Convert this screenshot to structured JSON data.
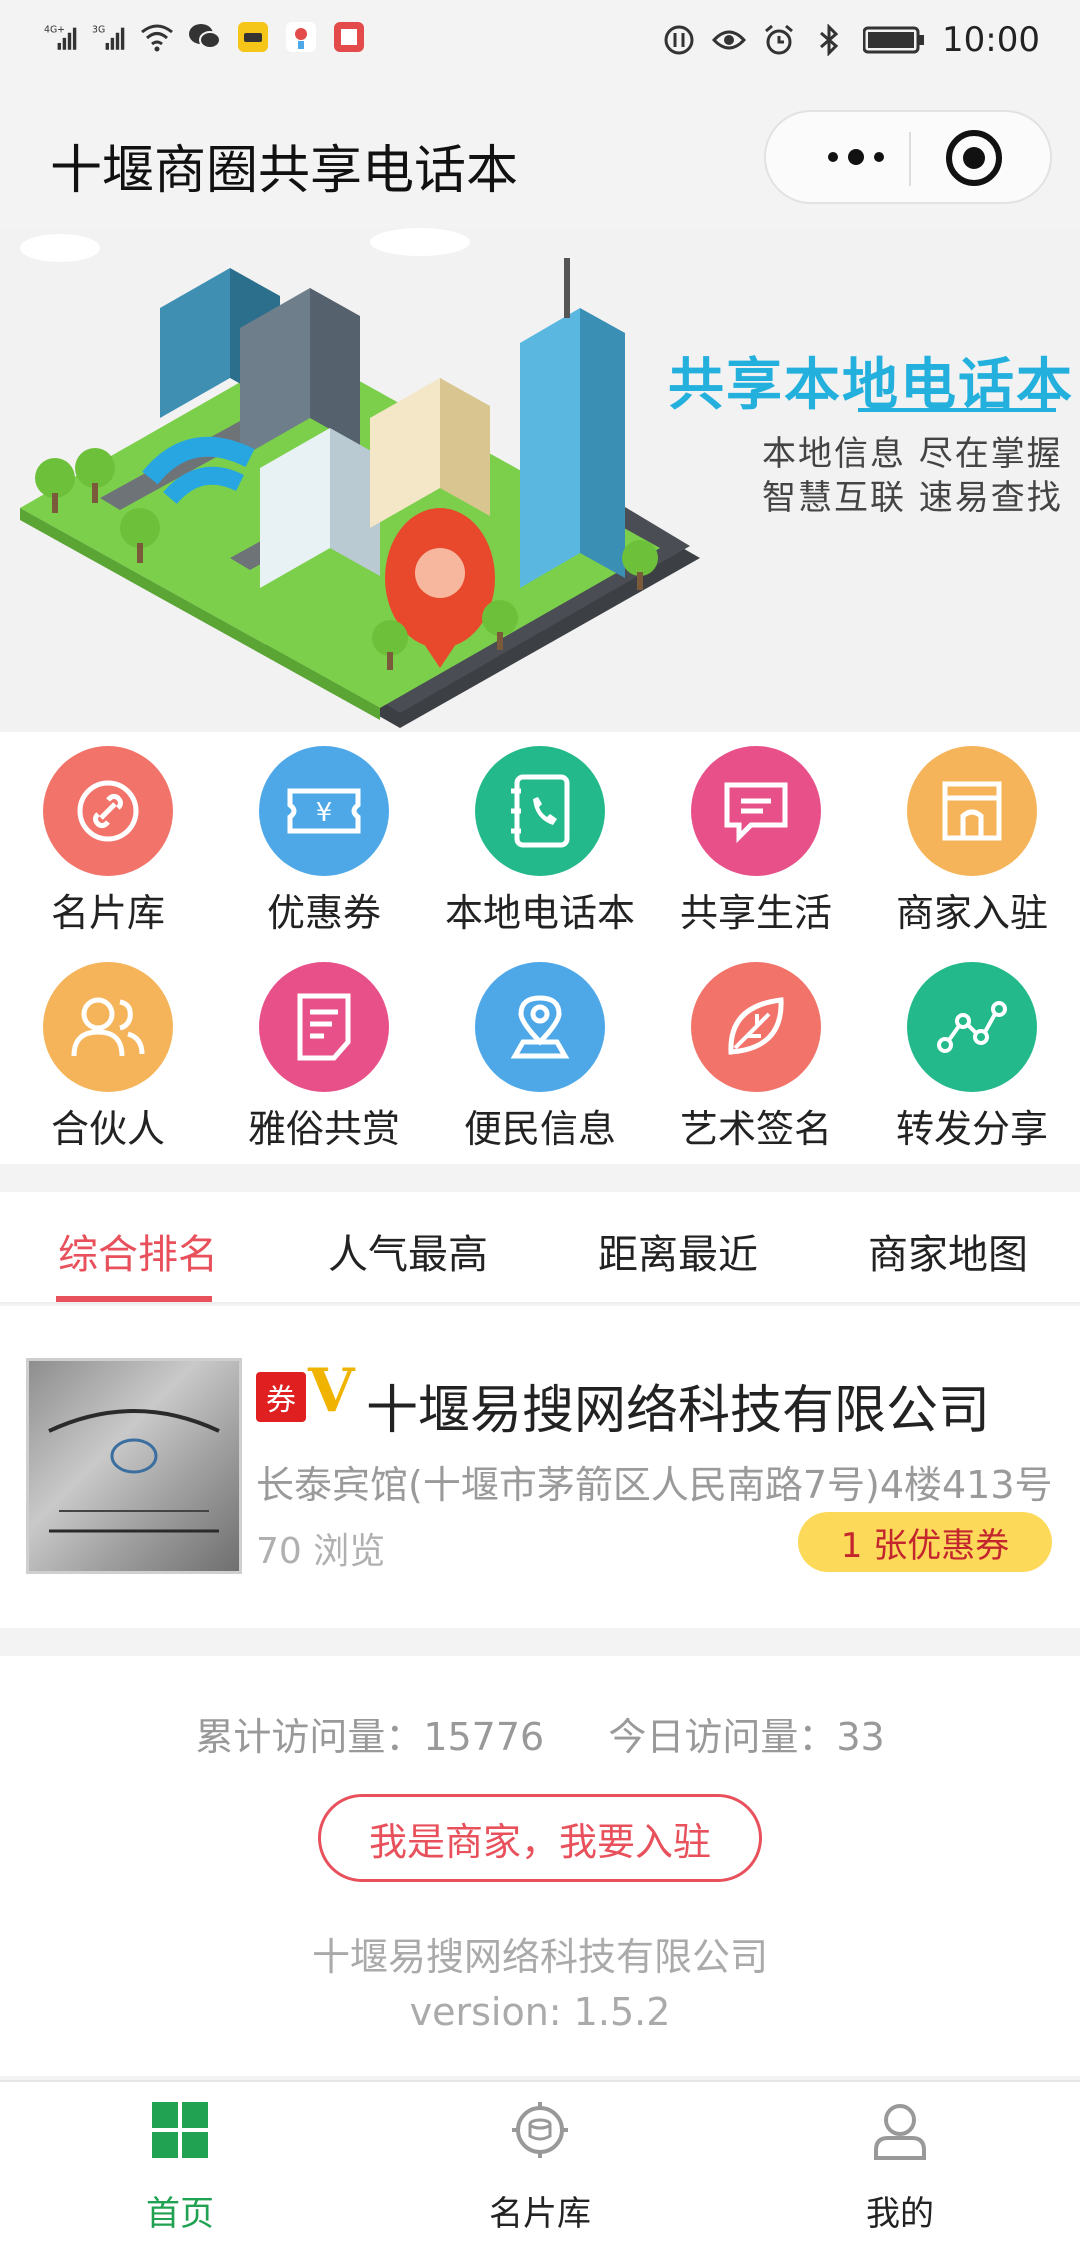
{
  "status_bar": {
    "network_1": "4G+",
    "network_2": "3G",
    "time": "10:00",
    "icons_left": [
      "signal-icon",
      "signal-icon",
      "wifi-icon",
      "wechat-icon",
      "car-icon",
      "map-pin-icon",
      "book-icon"
    ],
    "icons_right": [
      "data-icon",
      "eye-icon",
      "alarm-icon",
      "bluetooth-icon",
      "battery-icon"
    ]
  },
  "nav": {
    "title": "十堰商圈共享电话本"
  },
  "banner": {
    "headline": "共享本地电话本",
    "sub1": "本地信息 尽在掌握",
    "sub2": "智慧互联 速易查找",
    "accent": "#23b0dd"
  },
  "grid": {
    "items": [
      {
        "label": "名片库",
        "icon": "link-icon",
        "color": "#f2736a"
      },
      {
        "label": "优惠券",
        "icon": "ticket-icon",
        "color": "#4ea8e8"
      },
      {
        "label": "本地电话本",
        "icon": "phonebook-icon",
        "color": "#23b98b"
      },
      {
        "label": "共享生活",
        "icon": "chat-icon",
        "color": "#e8508a"
      },
      {
        "label": "商家入驻",
        "icon": "store-icon",
        "color": "#f5b45a"
      },
      {
        "label": "合伙人",
        "icon": "partners-icon",
        "color": "#f5b45a"
      },
      {
        "label": "雅俗共赏",
        "icon": "document-icon",
        "color": "#e8508a"
      },
      {
        "label": "便民信息",
        "icon": "location-icon",
        "color": "#4ea8e8"
      },
      {
        "label": "艺术签名",
        "icon": "leaf-icon",
        "color": "#f2736a"
      },
      {
        "label": "转发分享",
        "icon": "share-icon",
        "color": "#23b98b"
      }
    ]
  },
  "tabs": {
    "items": [
      "综合排名",
      "人气最高",
      "距离最近",
      "商家地图"
    ],
    "active_index": 0,
    "accent": "#e8505b"
  },
  "listing": {
    "coupon_badge": "券",
    "vip_badge": "V",
    "name": "十堰易搜网络科技有限公司",
    "address": "长泰宾馆(十堰市茅箭区人民南路7号)4楼413号",
    "views": "70 浏览",
    "coupon_pill": "1 张优惠券"
  },
  "footer": {
    "total_visits": "累计访问量：15776",
    "today_visits": "今日访问量：33",
    "join_button": "我是商家，我要入驻",
    "company": "十堰易搜网络科技有限公司",
    "version": "version: 1.5.2"
  },
  "tabbar": {
    "items": [
      {
        "label": "首页",
        "icon": "home-grid-icon"
      },
      {
        "label": "名片库",
        "icon": "cards-icon"
      },
      {
        "label": "我的",
        "icon": "user-icon"
      }
    ],
    "active_index": 0,
    "active_color": "#21a152"
  }
}
